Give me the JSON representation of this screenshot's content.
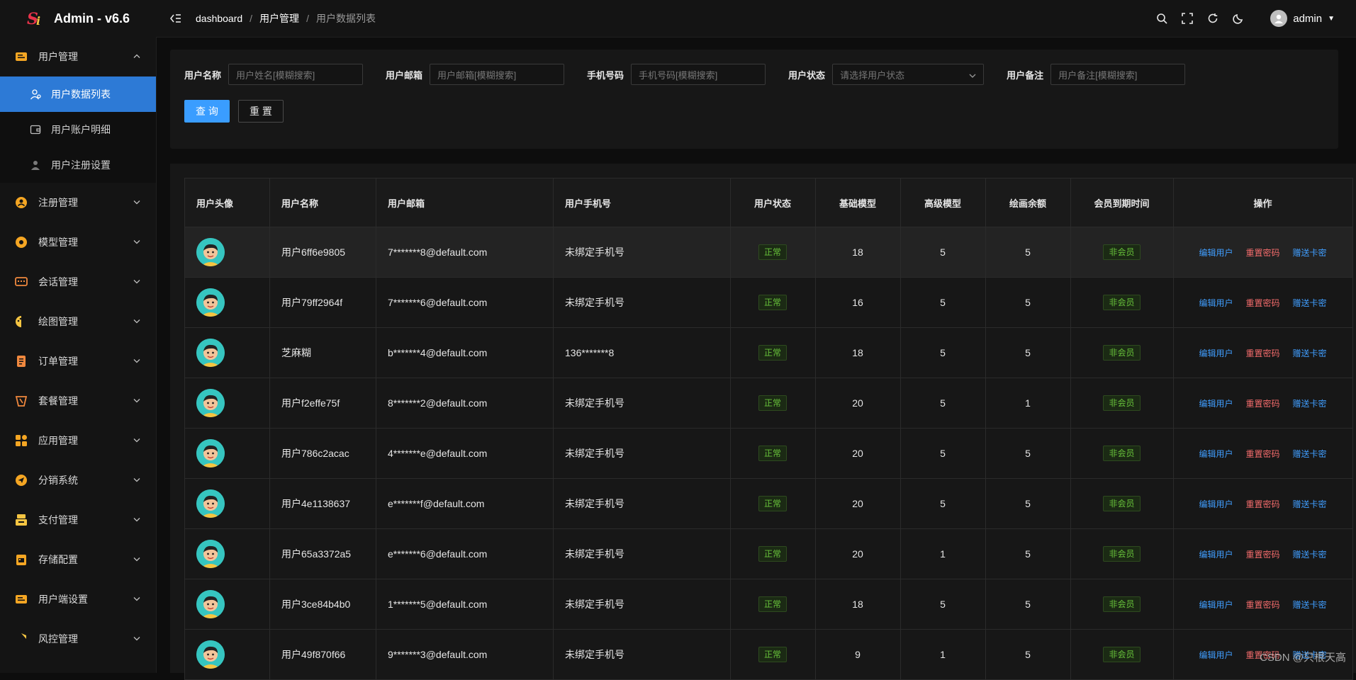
{
  "app": {
    "title": "Admin - v6.6"
  },
  "sidebar": {
    "items": [
      {
        "label": "用户管理",
        "icon": "user-card-icon",
        "color": "#f5a623",
        "open": true,
        "children": [
          {
            "label": "用户数据列表",
            "icon": "user-icon",
            "active": true
          },
          {
            "label": "用户账户明细",
            "icon": "wallet-icon",
            "active": false
          },
          {
            "label": "用户注册设置",
            "icon": "user-settings-icon",
            "active": false
          }
        ]
      },
      {
        "label": "注册管理",
        "icon": "register-icon",
        "color": "#f5a623"
      },
      {
        "label": "模型管理",
        "icon": "model-icon",
        "color": "#f5a623"
      },
      {
        "label": "会话管理",
        "icon": "chat-icon",
        "color": "#f0883e"
      },
      {
        "label": "绘图管理",
        "icon": "palette-icon",
        "color": "#f5c542"
      },
      {
        "label": "订单管理",
        "icon": "order-icon",
        "color": "#f0883e"
      },
      {
        "label": "套餐管理",
        "icon": "package-icon",
        "color": "#f0883e"
      },
      {
        "label": "应用管理",
        "icon": "apps-icon",
        "color": "#f5a623"
      },
      {
        "label": "分销系统",
        "icon": "share-icon",
        "color": "#f5a623"
      },
      {
        "label": "支付管理",
        "icon": "payment-icon",
        "color": "#f5c542"
      },
      {
        "label": "存储配置",
        "icon": "storage-icon",
        "color": "#f5a623"
      },
      {
        "label": "用户端设置",
        "icon": "client-settings-icon",
        "color": "#f5a623"
      },
      {
        "label": "风控管理",
        "icon": "shield-icon",
        "color": "#f5c542"
      }
    ]
  },
  "header": {
    "breadcrumb": [
      "dashboard",
      "用户管理",
      "用户数据列表"
    ],
    "username": "admin"
  },
  "search": {
    "fields": [
      {
        "label": "用户名称",
        "placeholder": "用户姓名[模糊搜索]"
      },
      {
        "label": "用户邮箱",
        "placeholder": "用户邮箱[模糊搜索]"
      },
      {
        "label": "手机号码",
        "placeholder": "手机号码[模糊搜索]"
      },
      {
        "label": "用户状态",
        "placeholder": "请选择用户状态"
      },
      {
        "label": "用户备注",
        "placeholder": "用户备注[模糊搜索]"
      }
    ],
    "query_label": "查 询",
    "reset_label": "重 置"
  },
  "table": {
    "columns": [
      "用户头像",
      "用户名称",
      "用户邮箱",
      "用户手机号",
      "用户状态",
      "基础模型",
      "高级模型",
      "绘画余额",
      "会员到期时间",
      "操作"
    ],
    "rows": [
      {
        "name": "用户6ff6e9805",
        "email": "7*******8@default.com",
        "phone": "未绑定手机号",
        "status": "正常",
        "base": "18",
        "adv": "5",
        "draw": "5",
        "vip": "非会员"
      },
      {
        "name": "用户79ff2964f",
        "email": "7*******6@default.com",
        "phone": "未绑定手机号",
        "status": "正常",
        "base": "16",
        "adv": "5",
        "draw": "5",
        "vip": "非会员"
      },
      {
        "name": "芝麻糊",
        "email": "b*******4@default.com",
        "phone": "136*******8",
        "status": "正常",
        "base": "18",
        "adv": "5",
        "draw": "5",
        "vip": "非会员"
      },
      {
        "name": "用户f2effe75f",
        "email": "8*******2@default.com",
        "phone": "未绑定手机号",
        "status": "正常",
        "base": "20",
        "adv": "5",
        "draw": "1",
        "vip": "非会员"
      },
      {
        "name": "用户786c2acac",
        "email": "4*******e@default.com",
        "phone": "未绑定手机号",
        "status": "正常",
        "base": "20",
        "adv": "5",
        "draw": "5",
        "vip": "非会员"
      },
      {
        "name": "用户4e1138637",
        "email": "e*******f@default.com",
        "phone": "未绑定手机号",
        "status": "正常",
        "base": "20",
        "adv": "5",
        "draw": "5",
        "vip": "非会员"
      },
      {
        "name": "用户65a3372a5",
        "email": "e*******6@default.com",
        "phone": "未绑定手机号",
        "status": "正常",
        "base": "20",
        "adv": "1",
        "draw": "5",
        "vip": "非会员"
      },
      {
        "name": "用户3ce84b4b0",
        "email": "1*******5@default.com",
        "phone": "未绑定手机号",
        "status": "正常",
        "base": "18",
        "adv": "5",
        "draw": "5",
        "vip": "非会员"
      },
      {
        "name": "用户49f870f66",
        "email": "9*******3@default.com",
        "phone": "未绑定手机号",
        "status": "正常",
        "base": "9",
        "adv": "1",
        "draw": "5",
        "vip": "非会员"
      }
    ],
    "actions": {
      "edit": "编辑用户",
      "reset": "重置密码",
      "gift": "赠送卡密"
    }
  },
  "watermark": "CSDN @只根天高"
}
